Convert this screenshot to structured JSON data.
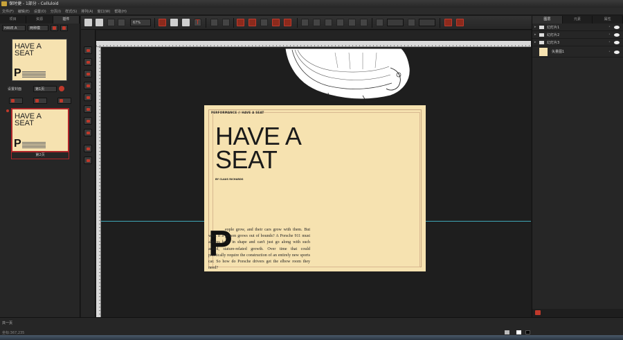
{
  "window": {
    "title": "保时捷 - 1部分 - Celluloid"
  },
  "menu": [
    "文件(F)",
    "编辑(E)",
    "设置(O)",
    "分页(I)",
    "样式(S)",
    "排列(A)",
    "窗口(W)",
    "帮助(H)"
  ],
  "left_panel": {
    "tabs": [
      "项目",
      "资源",
      "插件"
    ],
    "doc_select": "HAVE A",
    "layout_select": "两种模",
    "page1": {
      "title": "HAVE A\nSEAT",
      "label": "第1页"
    },
    "page_controls": {
      "label": "设置封面",
      "select": "第1页"
    },
    "page2": {
      "title": "HAVE A\nSEAT",
      "label": "第2页"
    }
  },
  "toolbar": {
    "zoom": "67%"
  },
  "page": {
    "kicker": "PERFORMANCE // HAVE A SEAT",
    "headline": "HAVE A\nSEAT",
    "byline": "BY CLAUS RICHARDS",
    "dropcap": "P",
    "body": "eople grow, and their cars grow with them. But what if a person grows out of bounds? A Porsche 911 must always keep in shape and can't just go along with such added, stature-related growth. Over time that could practically require the construction of an entirely new sports car. So how do Porsche drivers get the elbow room they need?"
  },
  "right_panel": {
    "tabs": [
      "图层",
      "元素",
      "属性"
    ],
    "layers": [
      {
        "name": "幻灯片1"
      },
      {
        "name": "幻灯片2"
      },
      {
        "name": "幻灯片3"
      },
      {
        "name": "矢量图1"
      }
    ]
  },
  "status": {
    "page_count": "共一页",
    "coords": "坐标:367,235"
  },
  "colors": {
    "accent": "#c0392b",
    "page_bg": "#f6e2b0",
    "guide": "#3fa7b8",
    "ui_bg": "#262626"
  }
}
